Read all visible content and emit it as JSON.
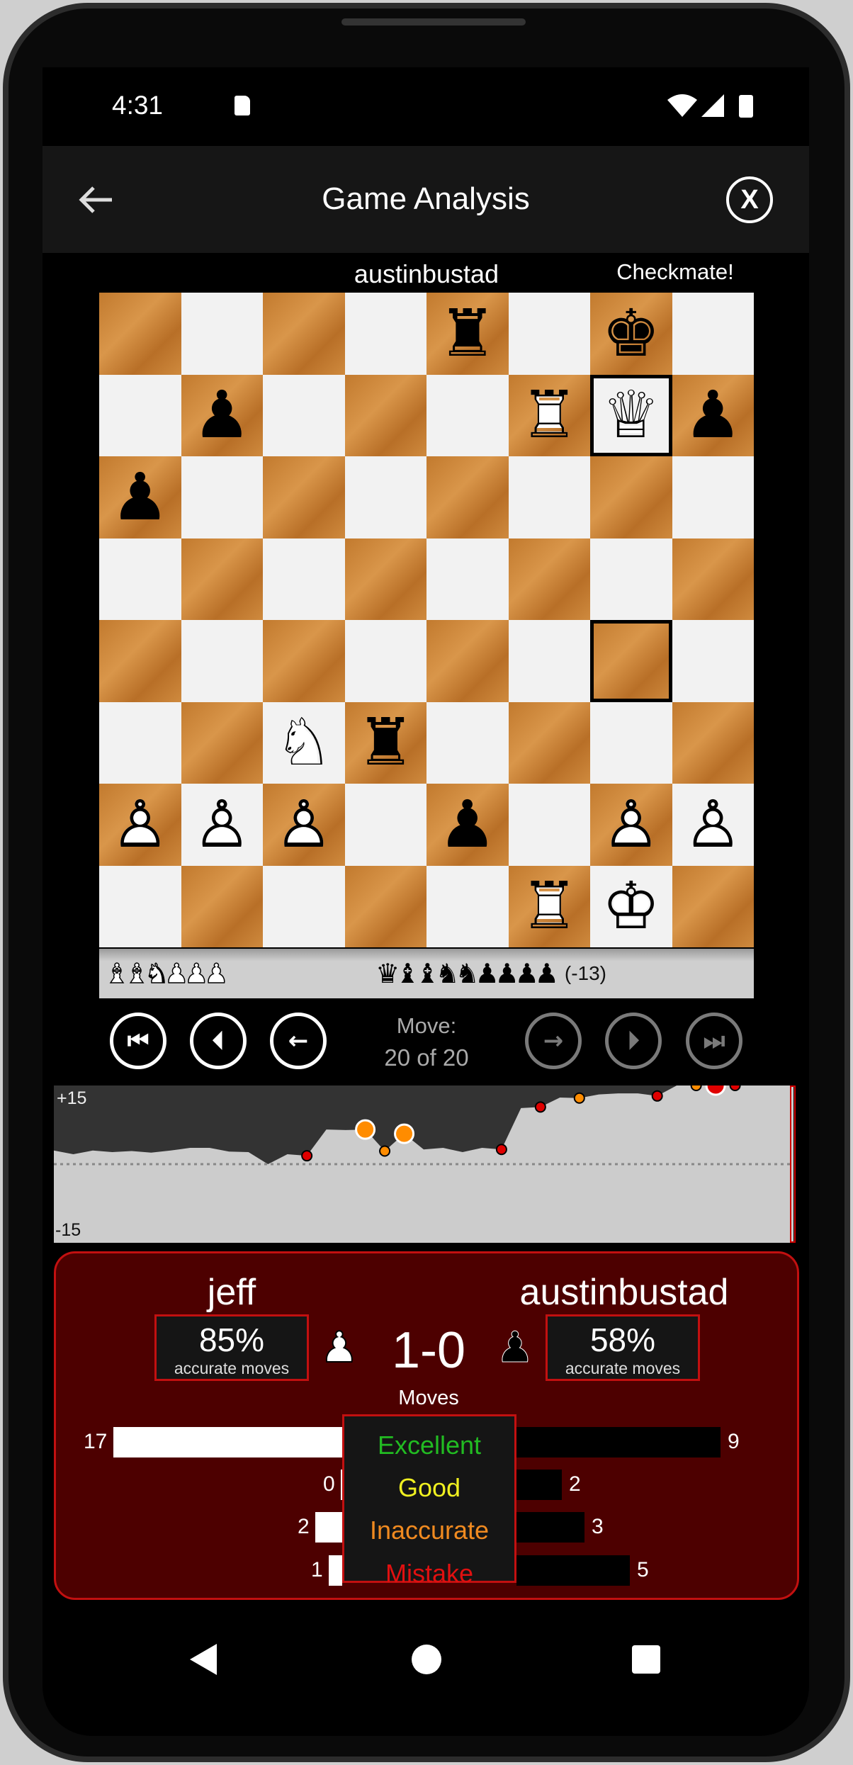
{
  "status_bar": {
    "time": "4:31",
    "icons": [
      "sd-card-icon",
      "wifi-icon",
      "signal-icon",
      "battery-icon"
    ]
  },
  "app_bar": {
    "title": "Game Analysis",
    "back_icon": "arrow-left-icon",
    "close_label": "X"
  },
  "top_player": {
    "name": "austinbustad",
    "result_text": "Checkmate!"
  },
  "board": {
    "highlighted_squares": [
      "g7",
      "g4"
    ],
    "pieces": [
      {
        "square": "e8",
        "piece": "rook",
        "color": "black"
      },
      {
        "square": "g8",
        "piece": "king",
        "color": "black"
      },
      {
        "square": "b7",
        "piece": "pawn",
        "color": "black"
      },
      {
        "square": "f7",
        "piece": "rook",
        "color": "white"
      },
      {
        "square": "g7",
        "piece": "queen",
        "color": "white"
      },
      {
        "square": "h7",
        "piece": "pawn",
        "color": "black"
      },
      {
        "square": "a6",
        "piece": "pawn",
        "color": "black"
      },
      {
        "square": "c3",
        "piece": "knight",
        "color": "white"
      },
      {
        "square": "d3",
        "piece": "rook",
        "color": "black"
      },
      {
        "square": "a2",
        "piece": "pawn",
        "color": "white"
      },
      {
        "square": "b2",
        "piece": "pawn",
        "color": "white"
      },
      {
        "square": "c2",
        "piece": "pawn",
        "color": "white"
      },
      {
        "square": "e2",
        "piece": "pawn",
        "color": "black"
      },
      {
        "square": "g2",
        "piece": "pawn",
        "color": "white"
      },
      {
        "square": "h2",
        "piece": "pawn",
        "color": "white"
      },
      {
        "square": "f1",
        "piece": "rook",
        "color": "white"
      },
      {
        "square": "g1",
        "piece": "king",
        "color": "white"
      }
    ]
  },
  "captured": {
    "left": "♝♝♞♟♟♟",
    "right": "♛♝♝♞♞♟♟♟♟",
    "material": "(-13)"
  },
  "navigation": {
    "move_label": "Move:",
    "move_position": "20 of 20",
    "buttons": [
      {
        "name": "first-move",
        "glyph": "⏮",
        "enabled": true
      },
      {
        "name": "prev-move-start",
        "glyph": "⏴",
        "enabled": true
      },
      {
        "name": "prev-move",
        "glyph": "←",
        "enabled": true
      },
      {
        "name": "next-move",
        "glyph": "→",
        "enabled": false
      },
      {
        "name": "next-move-end",
        "glyph": "⏵",
        "enabled": false
      },
      {
        "name": "last-move",
        "glyph": "⏭",
        "enabled": false
      }
    ]
  },
  "chart_data": {
    "type": "area",
    "ylim": [
      -15,
      15
    ],
    "ytick_labels": [
      "+15",
      "-15"
    ],
    "values": [
      2.6,
      1.9,
      2.6,
      2.3,
      2.5,
      2.2,
      2.6,
      3.1,
      3.1,
      2.4,
      2.3,
      0,
      1.9,
      1.6,
      6.6,
      6.5,
      6.6,
      2.5,
      5.8,
      2.8,
      3.1,
      2.3,
      3.1,
      2.8,
      10.7,
      10.9,
      12.7,
      12.6,
      13.3,
      13.5,
      13.5,
      13,
      15,
      15,
      15,
      15,
      15,
      15,
      15
    ],
    "markers": [
      {
        "index": 13,
        "type": "mistake"
      },
      {
        "index": 16,
        "type": "inaccurate",
        "highlighted": true
      },
      {
        "index": 17,
        "type": "inaccurate"
      },
      {
        "index": 18,
        "type": "inaccurate",
        "highlighted": true
      },
      {
        "index": 23,
        "type": "mistake"
      },
      {
        "index": 25,
        "type": "mistake"
      },
      {
        "index": 27,
        "type": "inaccurate"
      },
      {
        "index": 31,
        "type": "mistake"
      },
      {
        "index": 33,
        "type": "inaccurate"
      },
      {
        "index": 34,
        "type": "mistake",
        "highlighted": true
      },
      {
        "index": 35,
        "type": "mistake"
      }
    ],
    "colors": {
      "above": "#333333",
      "below": "#cccccc",
      "mistake": "#e00000",
      "inaccurate": "#ff8c00",
      "cursor": "#d00000"
    }
  },
  "summary": {
    "white": {
      "name": "jeff",
      "accuracy": "85%",
      "accuracy_label": "accurate moves"
    },
    "black": {
      "name": "austinbustad",
      "accuracy": "58%",
      "accuracy_label": "accurate moves"
    },
    "result": "1-0",
    "moves_label": "Moves",
    "categories": [
      {
        "label": "Excellent",
        "color": "#22bb22",
        "white": 17,
        "black": 9
      },
      {
        "label": "Good",
        "color": "#f0f020",
        "white": 0,
        "black": 2
      },
      {
        "label": "Inaccurate",
        "color": "#f08a20",
        "white": 2,
        "black": 3
      },
      {
        "label": "Mistake",
        "color": "#e01010",
        "white": 1,
        "black": 5
      }
    ]
  },
  "system_nav": [
    "back-triangle-icon",
    "home-circle-icon",
    "recents-square-icon"
  ]
}
